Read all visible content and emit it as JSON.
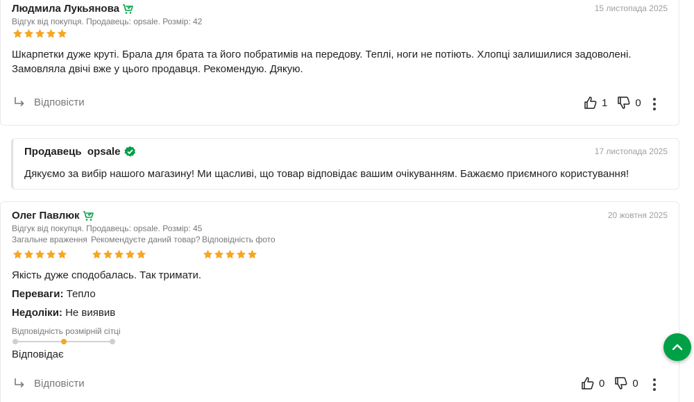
{
  "review1": {
    "author": "Людмила Лукьянова",
    "date": "15 листопада 2025",
    "meta": "Відгук від покупця. Продавець: opsale. Розмір: 42",
    "rating": 5,
    "text": "Шкарпетки дуже круті. Брала для брата та його побратимів на передову. Теплі, ноги не потіють. Хлопці залишилися задоволені. Замовляла двічі вже у цього продавця. Рекомендую. Дякую.",
    "reply_label": "Відповісти",
    "likes": "1",
    "dislikes": "0"
  },
  "seller_reply": {
    "label": "Продавець  opsale",
    "date": "17 листопада 2025",
    "text": "Дякуємо за вибір нашого магазину! Ми щасливі, що товар відповідає вашим очікуванням. Бажаємо приємного користування!"
  },
  "review2": {
    "author": "Олег Павлюк",
    "date": "20 жовтня 2025",
    "meta": "Відгук від покупця. Продавець: opsale. Розмір: 45",
    "criteria": [
      {
        "label": "Загальне враження",
        "rating": 5
      },
      {
        "label": "Рекомендуєте даний товар?",
        "rating": 5
      },
      {
        "label": "Відповідність фото",
        "rating": 5
      }
    ],
    "text": "Якість дуже сподобалась. Так тримати.",
    "pros_label": "Переваги:",
    "pros": "Тепло",
    "cons_label": "Недоліки:",
    "cons": "Не виявив",
    "size_fit_label": "Відповідність розмірній сітці",
    "size_fit_level": 0.5,
    "size_fit_value": "Відповідає",
    "reply_label": "Відповісти",
    "likes": "0",
    "dislikes": "0"
  },
  "colors": {
    "accent_green": "#00a046",
    "star": "#f5a623",
    "muted_text": "#797878"
  },
  "icons": {
    "verified_buyer": "cart-check-icon",
    "seller_verified": "check-badge-icon",
    "reply": "reply-arrow-icon",
    "like": "thumb-up-icon",
    "dislike": "thumb-down-icon",
    "more": "kebab-icon",
    "scroll_top": "chevron-up-icon"
  }
}
